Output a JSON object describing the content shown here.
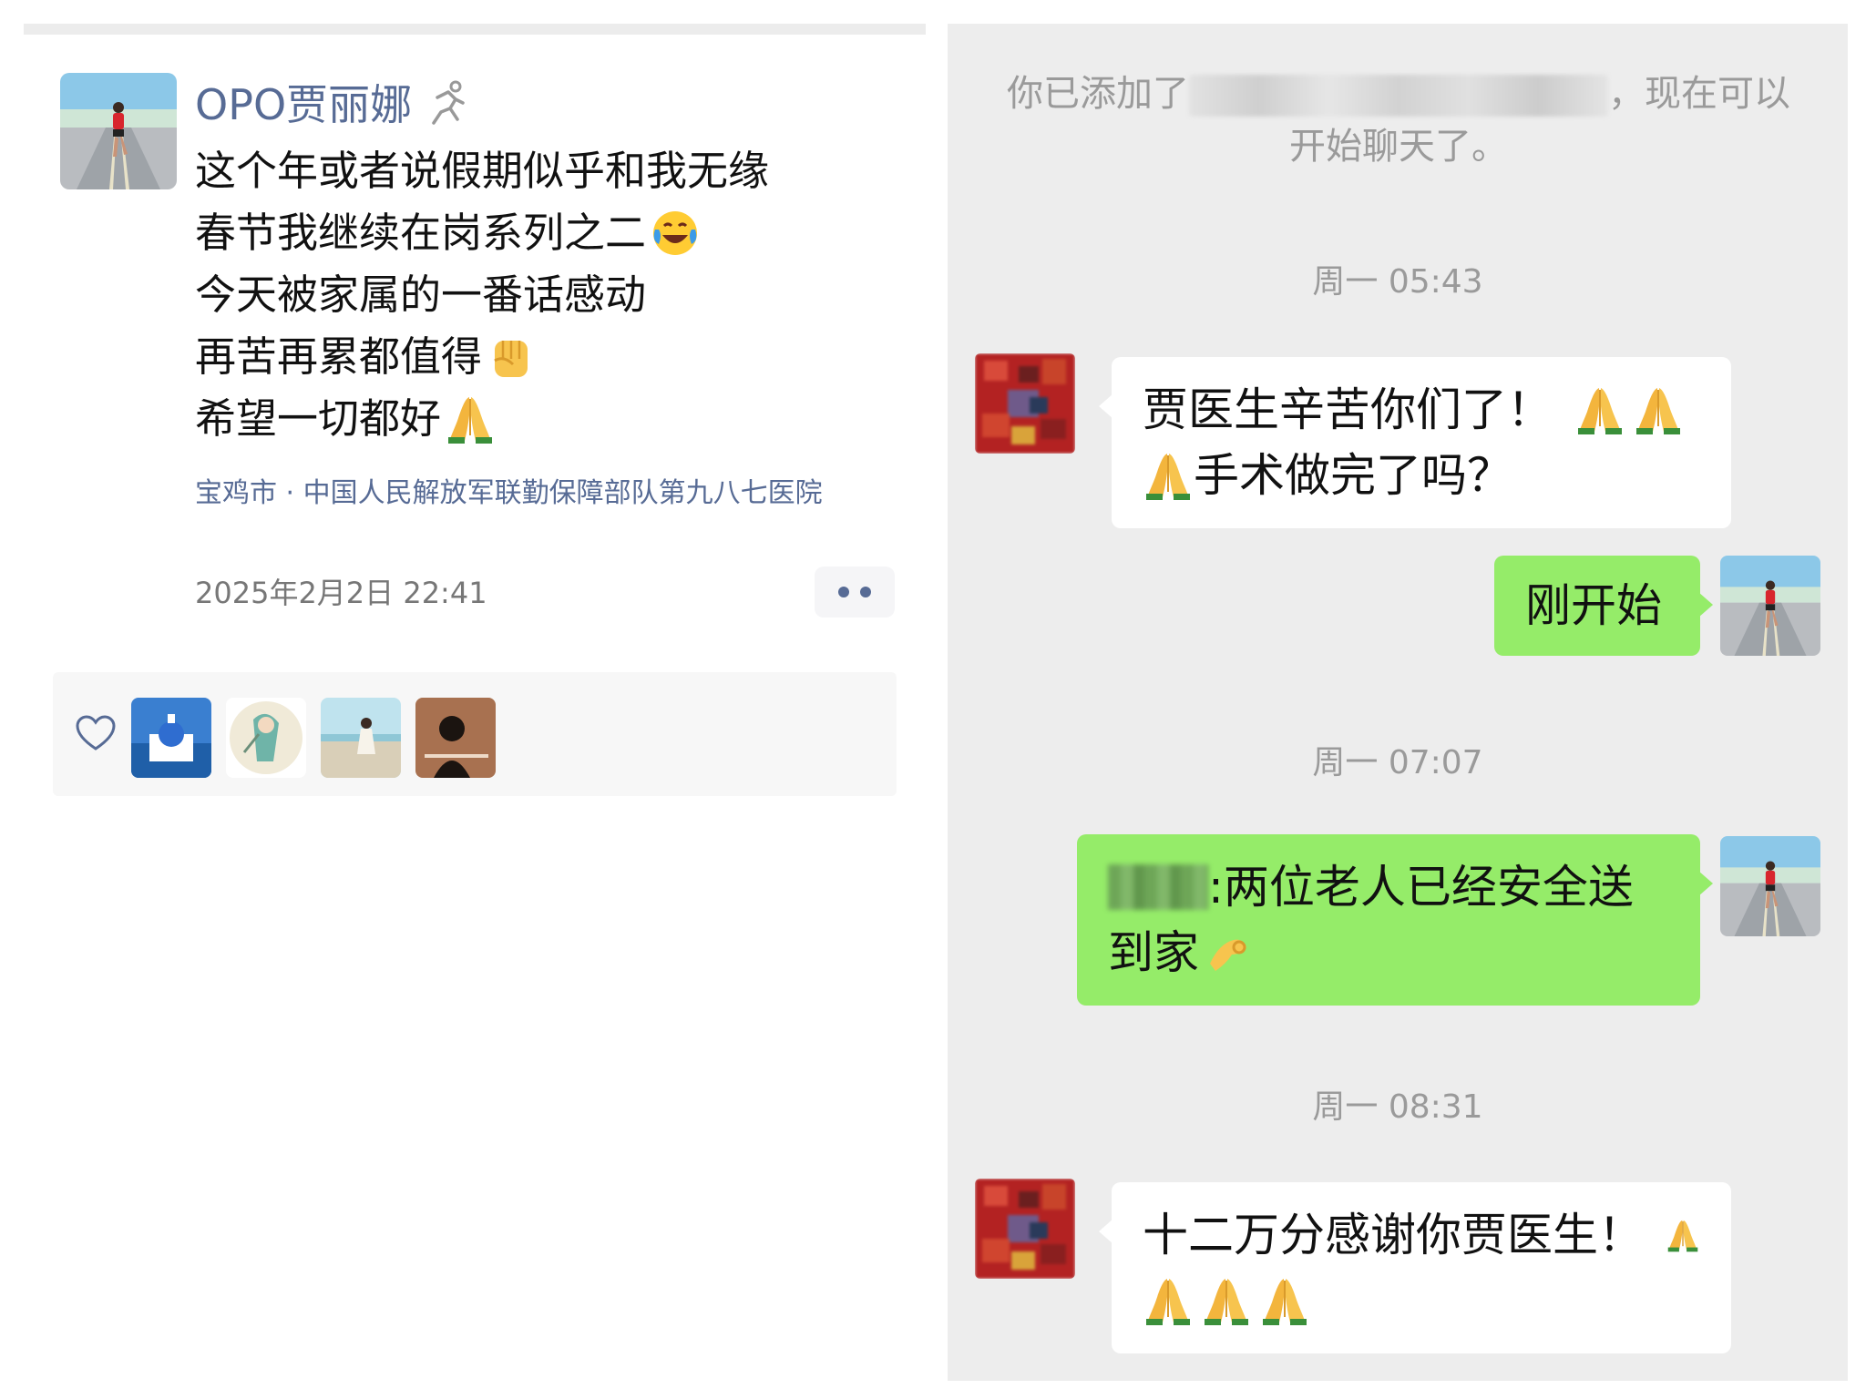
{
  "moments": {
    "author_name": "OPO贾丽娜",
    "lines": [
      "这个年或者说假期似乎和我无缘",
      "春节我继续在岗系列之二",
      "今天被家属的一番话感动",
      "再苦再累都值得",
      "希望一切都好"
    ],
    "location": "宝鸡市 · 中国人民解放军联勤保障部队第九八七医院",
    "timestamp": "2025年2月2日 22:41",
    "icons": {
      "author_status": "running-person-icon",
      "line2_emoji": "laughing-tears-emoji",
      "line4_emoji": "raised-fist-emoji",
      "line5_emoji": "folded-hands-emoji",
      "like": "heart-outline-icon",
      "more": "more-dots-icon"
    },
    "likes_count_avatars": 4
  },
  "chat": {
    "system_note_prefix": "你已添加了",
    "system_note_suffix": "，现在可以开始聊天了。",
    "messages": [
      {
        "time": "周一 05:43"
      },
      {
        "side": "left",
        "line1": "贾医生辛苦你们了！",
        "line2": "手术做完了吗？"
      },
      {
        "side": "right",
        "line1": "刚开始"
      },
      {
        "time": "周一 07:07"
      },
      {
        "side": "right",
        "line1": ":两位老人已经安全送",
        "line2": "到家"
      },
      {
        "time": "周一 08:31"
      },
      {
        "side": "left",
        "line1": "十二万分感谢你贾医生！"
      }
    ],
    "colors": {
      "background": "#ededed",
      "bubble_green": "#95ec69",
      "bubble_white": "#ffffff",
      "link_blue": "#576b95"
    }
  }
}
